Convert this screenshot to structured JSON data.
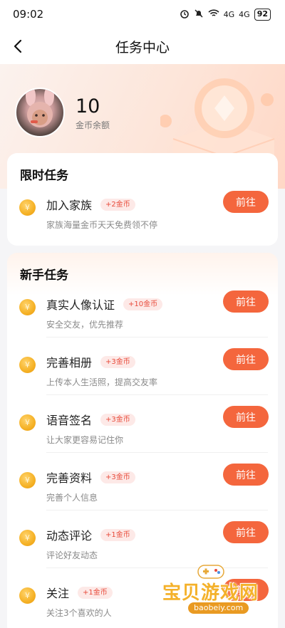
{
  "status_bar": {
    "time": "09:02",
    "battery": "92",
    "signal1": "4G",
    "signal2": "4G"
  },
  "nav": {
    "title": "任务中心"
  },
  "header": {
    "coin_amount": "10",
    "coin_label": "金币余额"
  },
  "limited": {
    "title": "限时任务",
    "tasks": [
      {
        "name": "加入家族",
        "reward": "+2金币",
        "desc": "家族海量金币天天免费领不停",
        "button": "前往"
      }
    ]
  },
  "newbie": {
    "title": "新手任务",
    "tasks": [
      {
        "name": "真实人像认证",
        "reward": "+10金币",
        "desc": "安全交友，优先推荐",
        "button": "前往"
      },
      {
        "name": "完善相册",
        "reward": "+3金币",
        "desc": "上传本人生活照，提高交友率",
        "button": "前往"
      },
      {
        "name": "语音签名",
        "reward": "+3金币",
        "desc": "让大家更容易记住你",
        "button": "前往"
      },
      {
        "name": "完善资料",
        "reward": "+3金币",
        "desc": "完善个人信息",
        "button": "前往"
      },
      {
        "name": "动态评论",
        "reward": "+1金币",
        "desc": "评论好友动态",
        "button": "前往"
      },
      {
        "name": "关注",
        "reward": "+1金币",
        "desc": "关注3个喜欢的人",
        "button": "前往"
      }
    ]
  },
  "coin_symbol": "¥",
  "watermark": {
    "text": "宝贝游戏网",
    "url": "baobeiy.com"
  },
  "colors": {
    "accent": "#f4663d",
    "reward_text": "#e84a3a",
    "reward_bg": "#fde9e7",
    "coin": "#f5b125"
  }
}
